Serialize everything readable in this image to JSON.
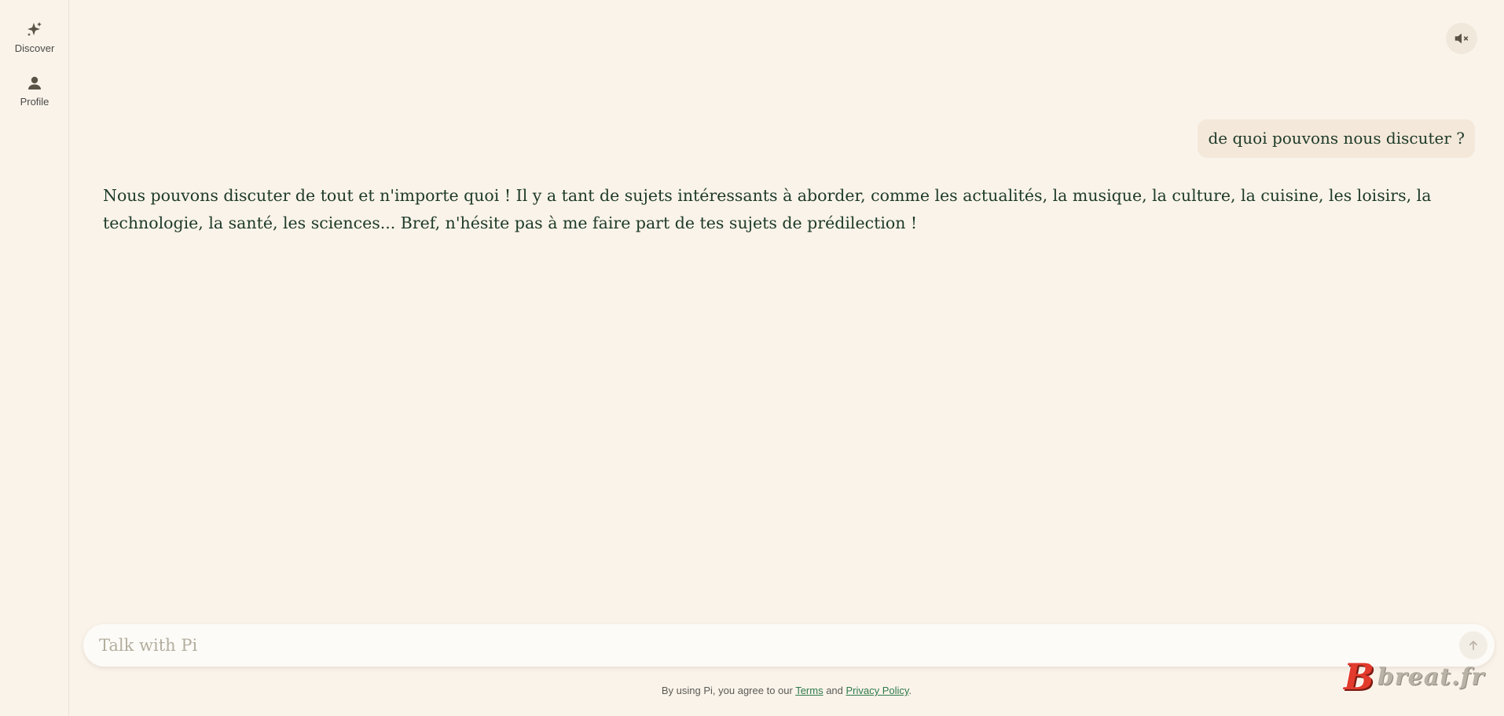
{
  "sidebar": {
    "items": [
      {
        "label": "Discover",
        "icon": "sparkle-icon"
      },
      {
        "label": "Profile",
        "icon": "user-icon"
      }
    ]
  },
  "header": {
    "mute_icon": "speaker-muted-icon"
  },
  "conversation": {
    "user_message": "de quoi pouvons nous discuter ?",
    "ai_message": "Nous pouvons discuter de tout et n'importe quoi ! Il y a tant de sujets intéressants à aborder, comme les actualités, la musique, la culture, la cuisine, les loisirs, la technologie, la santé, les sciences... Bref, n'hésite pas à me faire part de tes sujets de prédilection !"
  },
  "composer": {
    "placeholder": "Talk with Pi",
    "value": "",
    "send_icon": "arrow-up-icon"
  },
  "footer": {
    "prefix": "By using Pi, you agree to our ",
    "terms": "Terms",
    "and": " and ",
    "privacy": "Privacy Policy",
    "suffix": "."
  },
  "watermark": {
    "letter": "B",
    "text": "breat.fr"
  },
  "colors": {
    "background": "#faf3ea",
    "text": "#1d3a28",
    "user_bubble": "#f4e8da",
    "link": "#2f7a4a",
    "watermark_red": "#e23a2c"
  }
}
